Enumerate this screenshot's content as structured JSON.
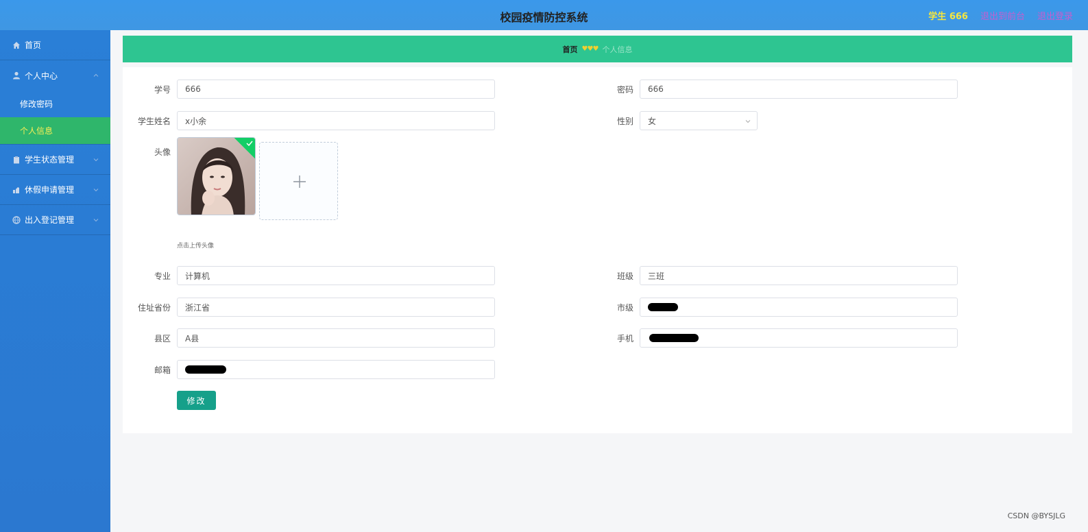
{
  "header": {
    "title": "校园疫情防控系统",
    "user": "学生 666",
    "links": [
      "退出到前台",
      "退出登录"
    ]
  },
  "sidebar": {
    "home": "首页",
    "personal_center": "个人中心",
    "sub_items": [
      "修改密码",
      "个人信息"
    ],
    "active_sub": "个人信息",
    "groups": [
      "学生状态管理",
      "休假申请管理",
      "出入登记管理"
    ]
  },
  "breadcrumb": {
    "home": "首页",
    "separator": "♥♥♥",
    "current": "个人信息"
  },
  "form": {
    "student_id": {
      "label": "学号",
      "value": "666"
    },
    "password": {
      "label": "密码",
      "value": "666"
    },
    "name": {
      "label": "学生姓名",
      "value": "x小余"
    },
    "gender": {
      "label": "性别",
      "value": "女"
    },
    "avatar": {
      "label": "头像",
      "tip": "点击上传头像"
    },
    "major": {
      "label": "专业",
      "value": "计算机"
    },
    "class": {
      "label": "班级",
      "value": "三班"
    },
    "province": {
      "label": "住址省份",
      "value": "浙江省"
    },
    "city": {
      "label": "市级",
      "value": ""
    },
    "county": {
      "label": "县区",
      "value": "A县"
    },
    "phone": {
      "label": "手机",
      "value": ""
    },
    "email": {
      "label": "邮箱",
      "value": ""
    },
    "submit_label": "修改"
  },
  "watermark": "CSDN @BYSJLG",
  "colors": {
    "header": "#3b98ea",
    "sidebar": "#2a7fd7",
    "breadcrumb": "#2ec591",
    "active_menu": "#2fb66b",
    "button": "#16a08a"
  },
  "icons": [
    "home-icon",
    "user-icon",
    "clipboard-icon",
    "vacation-icon",
    "globe-icon",
    "chevron-up-icon",
    "chevron-down-icon",
    "plus-icon",
    "check-icon"
  ]
}
